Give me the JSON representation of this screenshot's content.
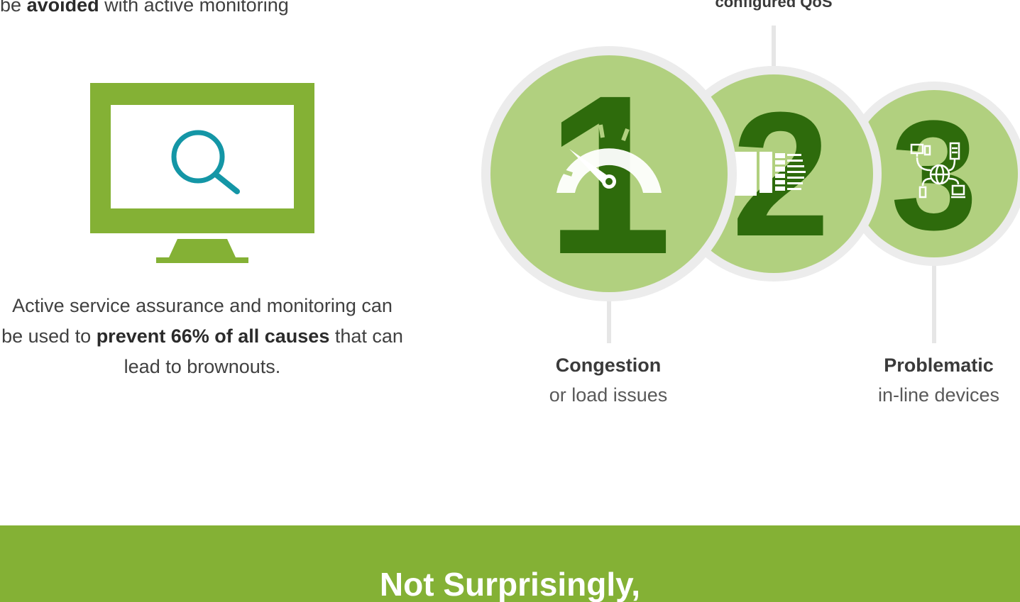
{
  "intro": {
    "prefix": "be",
    "emphasis": "avoided",
    "suffix": "with active monitoring"
  },
  "caption": {
    "part1": "Active service assurance and monitoring can be used to",
    "emphasis": "prevent 66% of all causes",
    "part2": "that can lead to brownouts."
  },
  "causes": {
    "top_label": "configured QoS",
    "items": [
      {
        "number": "1",
        "title": "Congestion",
        "subtitle": "or load issues",
        "icon": "speedometer-icon"
      },
      {
        "number": "2",
        "title": "",
        "subtitle": "",
        "icon": "qos-bars-icon"
      },
      {
        "number": "3",
        "title": "Problematic",
        "subtitle": "in-line devices",
        "icon": "network-devices-icon"
      }
    ]
  },
  "banner": {
    "title": "Not Surprisingly,"
  },
  "colors": {
    "brand_green": "#84b135",
    "light_green": "#b1d07f",
    "dark_green": "#2e6b0c",
    "search_teal": "#1496a6",
    "ring_gray": "#ececec"
  }
}
